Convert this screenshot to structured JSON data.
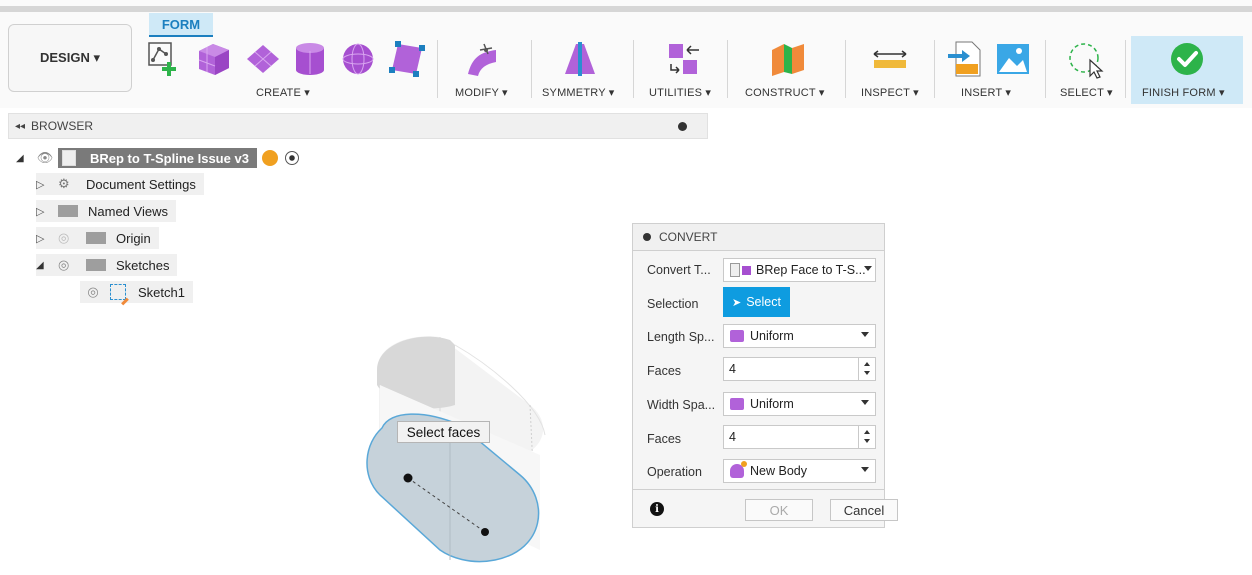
{
  "toolbar": {
    "design_label": "DESIGN ▾",
    "form_tab": "FORM",
    "groups": {
      "create": "CREATE ▾",
      "modify": "MODIFY ▾",
      "symmetry": "SYMMETRY ▾",
      "utilities": "UTILITIES ▾",
      "construct": "CONSTRUCT ▾",
      "inspect": "INSPECT ▾",
      "insert": "INSERT ▾",
      "select": "SELECT ▾",
      "finish": "FINISH FORM ▾"
    }
  },
  "browser": {
    "title": "BROWSER",
    "root": "BRep to T-Spline Issue v3",
    "items": [
      {
        "label": "Document Settings"
      },
      {
        "label": "Named Views"
      },
      {
        "label": "Origin"
      },
      {
        "label": "Sketches"
      },
      {
        "label": "Sketch1"
      }
    ]
  },
  "dialog": {
    "title": "CONVERT",
    "rows": {
      "convert_type_label": "Convert T...",
      "convert_type_value": "BRep Face to T-S...",
      "selection_label": "Selection",
      "selection_button": "Select",
      "length_label": "Length Sp...",
      "length_value": "Uniform",
      "length_faces_label": "Faces",
      "length_faces_value": "4",
      "width_label": "Width Spa...",
      "width_value": "Uniform",
      "width_faces_label": "Faces",
      "width_faces_value": "4",
      "operation_label": "Operation",
      "operation_value": "New Body"
    },
    "ok_label": "OK",
    "cancel_label": "Cancel",
    "info_icon": "info-icon"
  },
  "canvas": {
    "tooltip": "Select faces"
  },
  "colors": {
    "accent": "#1c7fbf",
    "select_button": "#0e9ce0",
    "tspline_purple": "#a64fd0",
    "finish_green": "#2db34a"
  }
}
